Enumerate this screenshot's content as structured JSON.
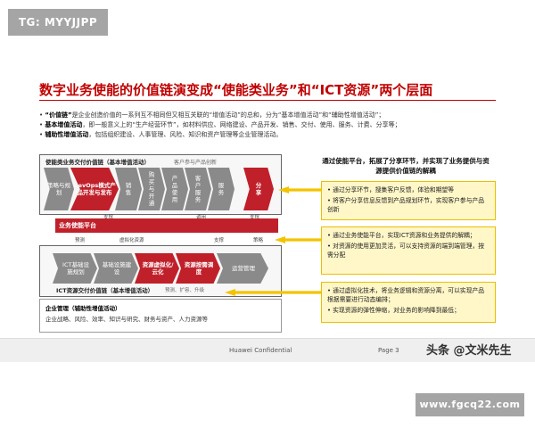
{
  "tag": "TG: MYYJJPP",
  "title": "数字业务使能的价值链演变成“使能类业务”和“ICT资源”两个层面",
  "bullets": [
    {
      "bold": "“价值链”",
      "text": "是企业创造价值的一系列互不相同但又相互关联的“增值活动”的总和，分为“基本增值活动”和“辅助性增值活动”；"
    },
    {
      "bold": "基本增值活动",
      "text": "，即一般意义上的“生产经营环节”，如材料供应、网络建设、产品开发、销售、交付、使用、服务、计费、分享等；"
    },
    {
      "bold": "辅助性增值活动",
      "text": "，包括组织建设、人事管理、风险、知识和资产管理等企业管理活动。"
    }
  ],
  "top_panel": {
    "caption": "使能类业务交付价值链（基本增值活动）",
    "caption_right": "客户参与产品创新",
    "steps": [
      "策略与规划",
      "DevOps模式产品开发与发布",
      "销售",
      "购买与开通",
      "产品使用",
      "客户服务",
      "服务",
      "分享"
    ]
  },
  "platform": {
    "label": "业务使能平台",
    "links_top": [
      "支撑",
      "调用",
      "支撑"
    ],
    "links_bottom": [
      "预测",
      "虚拟化资源",
      "支撑",
      "策略"
    ]
  },
  "bottom_panel": {
    "steps": [
      "ICT基础设施规划",
      "基础设施建设",
      "资源虚拟化/云化",
      "资源按需调度",
      "运营管理"
    ],
    "caption": "ICT资源交付价值链（基本增值活动）",
    "caption_right": "预测、扩容、升级"
  },
  "management": {
    "title": "企业管理（辅助性增值活动）",
    "text": "企业战略、风险、效率、知识与研究、财务与资产、人力资源等"
  },
  "right_header": "通过使能平台，拓展了分享环节，并实现了业务提供与资源提供价值链的解耦",
  "right_boxes": [
    [
      "通过分享环节，搜集客户反馈，体验和期望等",
      "将客户分享信息反馈到产品规划环节，实现客户参与产品创新"
    ],
    [
      "通过业务使能平台，实现ICT资源和业务提供的解耦；",
      "对资源的使用更加灵活，可以支持资源的端到端管理，按需分配"
    ],
    [
      "通过虚拟化技术，将业务逻辑和资源分离，可以实现产品根据需要进行动态编排；",
      "实现资源的弹性伸缩，对业务的影响降到最低；"
    ]
  ],
  "footer": {
    "confidential": "Huawei Confidential",
    "page": "Page 3"
  },
  "watermark_1": "头条 @文米先生",
  "watermark_2": "www.fgcq22.com",
  "colors": {
    "accent_red": "#c0202a",
    "highlight_yellow": "#fff7c8",
    "arrow_yellow": "#f3c300",
    "grey": "#8a8a8a"
  }
}
